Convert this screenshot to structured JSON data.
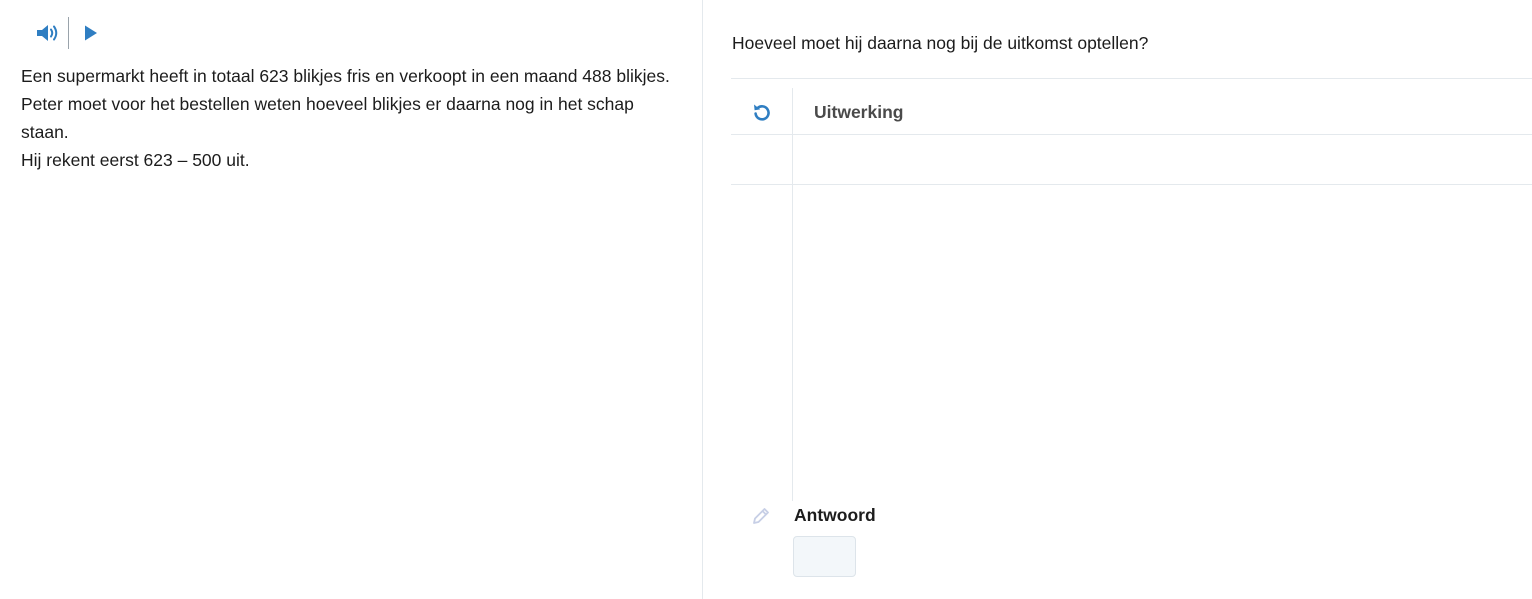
{
  "colors": {
    "accent": "#2f7ec2",
    "divider": "#e4e9ed",
    "input_bg": "#f3f7fa",
    "pencil": "#c7cfe6"
  },
  "audio": {
    "speaker_icon": "speaker-icon",
    "play_icon": "play-icon"
  },
  "story": {
    "lines": [
      "Een supermarkt heeft in totaal 623 blikjes fris en verkoopt in een maand 488 blikjes.",
      "Peter moet voor het bestellen weten hoeveel blikjes er daarna nog in het schap staan.",
      "Hij rekent eerst 623 – 500 uit."
    ]
  },
  "question": {
    "text": "Hoeveel moet hij daarna nog bij de uitkomst optellen?"
  },
  "workspace": {
    "reset_icon": "reset-icon",
    "title": "Uitwerking"
  },
  "answer": {
    "pencil_icon": "pencil-icon",
    "label": "Antwoord",
    "value": ""
  }
}
